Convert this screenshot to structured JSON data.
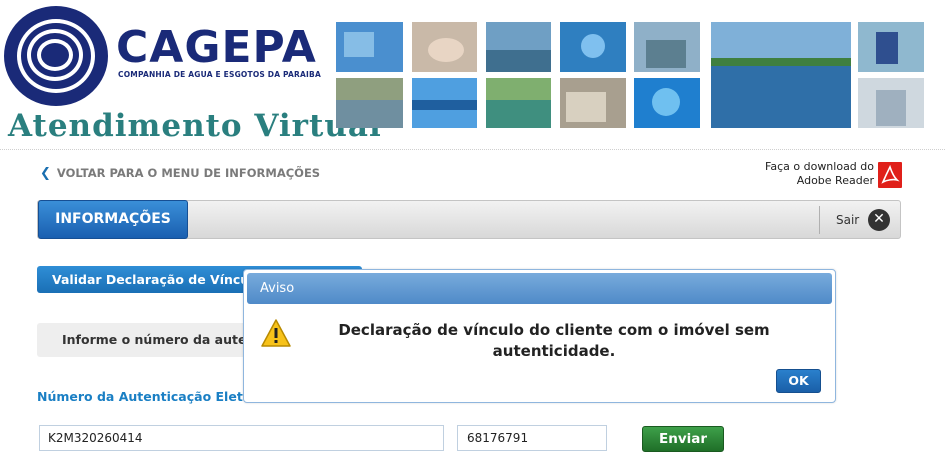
{
  "header": {
    "brand": "CAGEPA",
    "brand_subtitle": "COMPANHIA DE AGUA E ESGOTOS DA PARAIBA",
    "portal_title": "Atendimento Virtual"
  },
  "nav": {
    "back_label": "VOLTAR PARA O MENU DE INFORMAÇÕES",
    "download_line1": "Faça o download do",
    "download_line2": "Adobe Reader",
    "tab_label": "INFORMAÇÕES",
    "logout_label": "Sair"
  },
  "form": {
    "section_title": "Validar Declaração de Vínculo",
    "info_text": "Informe o número da autenticação",
    "field_label": "Número da Autenticação Eletrônica",
    "auth_code_value": "K2M320260414",
    "second_value": "68176791",
    "submit_label": "Enviar"
  },
  "dialog": {
    "title": "Aviso",
    "message": "Declaração de vínculo do cliente com o imóvel sem autenticidade.",
    "ok_label": "OK"
  },
  "colors": {
    "brand_blue": "#1a2a78",
    "portal_teal": "#2a7f7f",
    "accent_blue": "#1a6fb5",
    "submit_green": "#2f8a3a"
  }
}
